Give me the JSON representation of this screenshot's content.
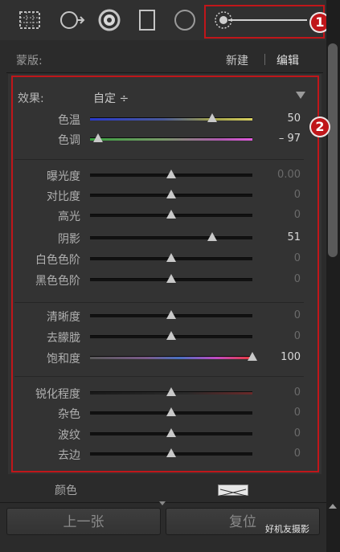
{
  "toolbar": {
    "tools": [
      "crop-grid-icon",
      "spot-removal-icon",
      "red-eye-icon",
      "graduated-filter-icon",
      "radial-filter-icon",
      "adjustment-brush-icon"
    ]
  },
  "annotations": {
    "badge1": "1",
    "badge2": "2"
  },
  "mask": {
    "label": "蒙版:",
    "new_label": "新建",
    "edit_label": "编辑"
  },
  "effect": {
    "label": "效果:",
    "value": "自定 ÷"
  },
  "sliders": [
    {
      "label": "色温",
      "value": "50",
      "position": 0.75
    },
    {
      "label": "色调",
      "value": "– 97",
      "position": 0.05
    },
    {
      "label": "曝光度",
      "value": "0.00",
      "position": 0.5
    },
    {
      "label": "对比度",
      "value": "0",
      "position": 0.5
    },
    {
      "label": "高光",
      "value": "0",
      "position": 0.5
    },
    {
      "label": "阴影",
      "value": "51",
      "position": 0.75
    },
    {
      "label": "白色色阶",
      "value": "0",
      "position": 0.5
    },
    {
      "label": "黑色色阶",
      "value": "0",
      "position": 0.5
    },
    {
      "label": "清晰度",
      "value": "0",
      "position": 0.5
    },
    {
      "label": "去朦胧",
      "value": "0",
      "position": 0.5
    },
    {
      "label": "饱和度",
      "value": "100",
      "position": 1.0
    },
    {
      "label": "锐化程度",
      "value": "0",
      "position": 0.5
    },
    {
      "label": "杂色",
      "value": "0",
      "position": 0.5
    },
    {
      "label": "波纹",
      "value": "0",
      "position": 0.5
    },
    {
      "label": "去边",
      "value": "0",
      "position": 0.5
    }
  ],
  "color": {
    "label": "颜色"
  },
  "buttons": {
    "previous": "上一张",
    "reset": "复位"
  },
  "watermark": "好机友摄影",
  "colors": {
    "annotation_red": "#c0161a",
    "background": "#2b2b2b"
  }
}
